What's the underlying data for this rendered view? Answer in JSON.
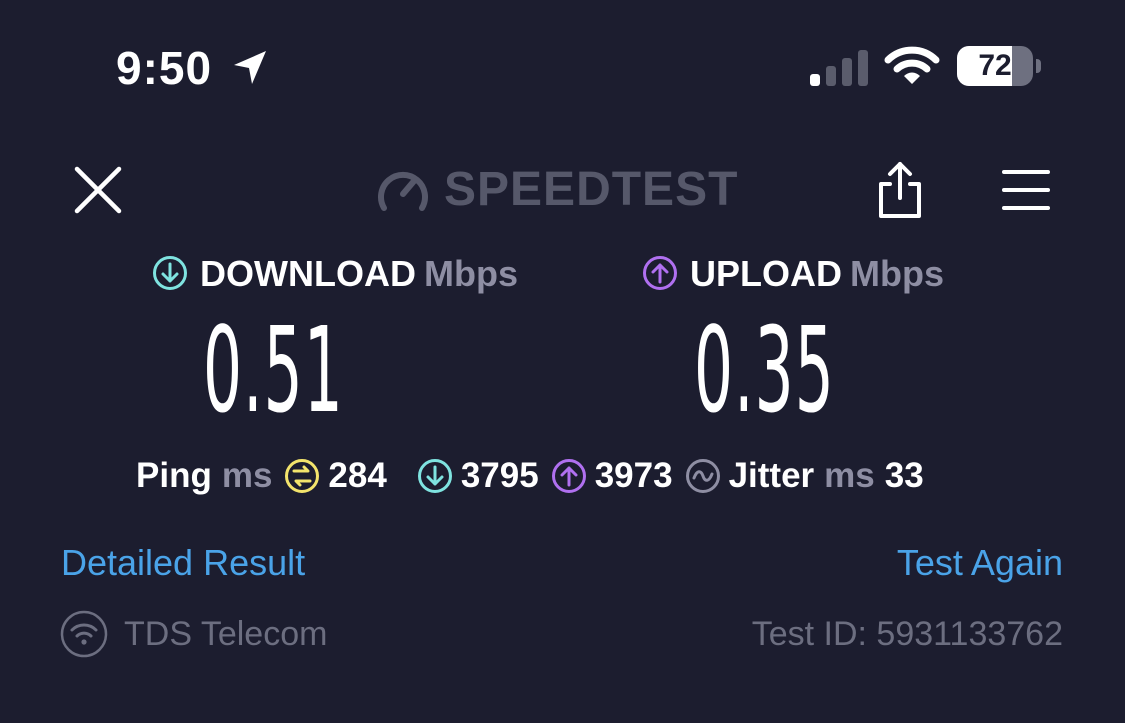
{
  "status_bar": {
    "time": "9:50",
    "battery_percent": "72",
    "battery_level": 0.72,
    "signal_bars_active": 1,
    "location_icon": "location-arrow-icon",
    "wifi_icon": "wifi-icon"
  },
  "header": {
    "logo_text": "SPEEDTEST",
    "close_icon": "close-icon",
    "share_icon": "share-icon",
    "menu_icon": "menu-icon"
  },
  "download": {
    "label": "DOWNLOAD",
    "unit": "Mbps",
    "value": "0.51",
    "color": "#7fe3e0"
  },
  "upload": {
    "label": "UPLOAD",
    "unit": "Mbps",
    "value": "0.35",
    "color": "#b070f0"
  },
  "latency": {
    "ping_label": "Ping",
    "ping_unit": "ms",
    "ping_value": "284",
    "ping_color": "#f3e46c",
    "download_latency": "3795",
    "upload_latency": "3973",
    "jitter_label": "Jitter",
    "jitter_unit": "ms",
    "jitter_value": "33"
  },
  "links": {
    "detailed_result": "Detailed Result",
    "test_again": "Test Again",
    "link_color": "#4aa3e8"
  },
  "footer": {
    "isp_name": "TDS Telecom",
    "test_id": "Test ID: 5931133762"
  }
}
